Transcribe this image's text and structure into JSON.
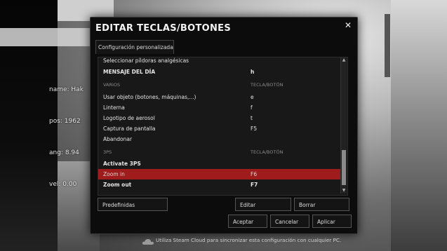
{
  "hud": {
    "lines": [
      "name: Hak",
      "pos: 1962",
      "ang: 8.94",
      "vel: 0.00"
    ]
  },
  "dialog": {
    "title": "EDITAR TECLAS/BOTONES",
    "tab_label": "Configuración personalizada",
    "rows": [
      {
        "label": "Seleccionar píldoras analgésicas",
        "key": "",
        "type": "item"
      },
      {
        "label": "MENSAJE DEL DÍA",
        "key": "h",
        "type": "item"
      },
      {
        "label": "VARIOS",
        "key": "TECLA/BOTÓN",
        "type": "section"
      },
      {
        "label": "Usar objeto (botones, máquinas,...)",
        "key": "e",
        "type": "item"
      },
      {
        "label": "Linterna",
        "key": "f",
        "type": "item"
      },
      {
        "label": "Logotipo de aerosol",
        "key": "t",
        "type": "item"
      },
      {
        "label": "Captura de pantalla",
        "key": "F5",
        "type": "item"
      },
      {
        "label": "Abandonar",
        "key": "",
        "type": "item"
      },
      {
        "label": "3PS",
        "key": "TECLA/BOTÓN",
        "type": "section"
      },
      {
        "label": "Activate 3PS",
        "key": "",
        "type": "item"
      },
      {
        "label": "Zoom in",
        "key": "F6",
        "type": "selected"
      },
      {
        "label": "Zoom out",
        "key": "F7",
        "type": "item"
      }
    ],
    "buttons": {
      "defaults": "Predefinidas",
      "edit": "Editar",
      "delete": "Borrar",
      "accept": "Aceptar",
      "cancel": "Cancelar",
      "apply": "Aplicar"
    },
    "footer": "Utiliza Steam Cloud para sincronizar esta configuración con cualquier PC.",
    "colors": {
      "selected_row": "#a01c1c",
      "background": "#0c0c0c"
    }
  }
}
